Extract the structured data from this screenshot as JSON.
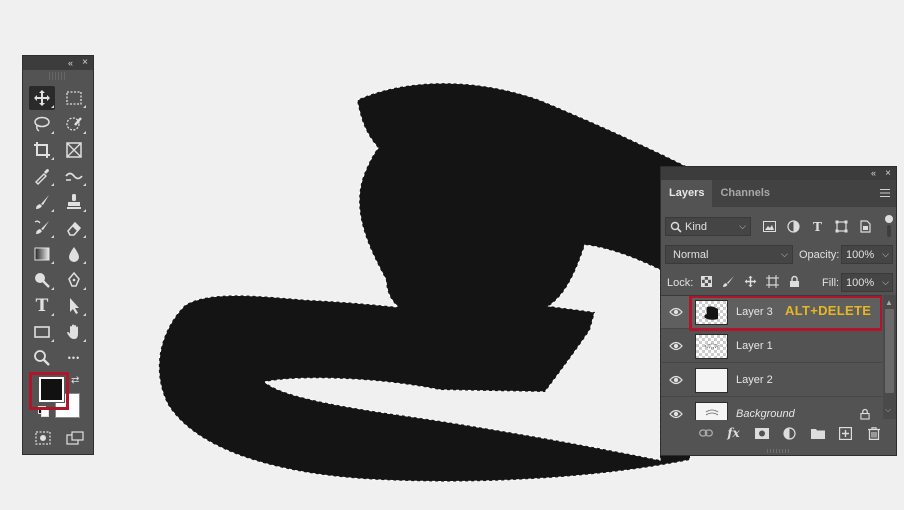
{
  "tools_panel": {
    "collapse_glyph": "«",
    "close_glyph": "×",
    "tools": [
      {
        "name": "move-tool",
        "icon": "move-icon",
        "active": true
      },
      {
        "name": "marquee-tool",
        "icon": "rect-marquee-icon"
      },
      {
        "name": "lasso-tool",
        "icon": "lasso-icon"
      },
      {
        "name": "quick-select-tool",
        "icon": "quick-select-icon"
      },
      {
        "name": "crop-tool",
        "icon": "crop-icon"
      },
      {
        "name": "frame-tool",
        "icon": "frame-icon"
      },
      {
        "name": "eyedropper-tool",
        "icon": "eyedropper-icon"
      },
      {
        "name": "healing-tool",
        "icon": "healing-icon"
      },
      {
        "name": "brush-tool",
        "icon": "brush-icon"
      },
      {
        "name": "stamp-tool",
        "icon": "stamp-icon"
      },
      {
        "name": "history-brush-tool",
        "icon": "history-brush-icon"
      },
      {
        "name": "eraser-tool",
        "icon": "eraser-icon"
      },
      {
        "name": "gradient-tool",
        "icon": "gradient-icon"
      },
      {
        "name": "blur-tool",
        "icon": "drop-icon"
      },
      {
        "name": "dodge-tool",
        "icon": "dodge-icon"
      },
      {
        "name": "pen-tool",
        "icon": "pen-icon"
      },
      {
        "name": "type-tool",
        "icon": "type-icon",
        "text": "T"
      },
      {
        "name": "path-select-tool",
        "icon": "arrow-icon"
      },
      {
        "name": "shape-tool",
        "icon": "rectangle-icon"
      },
      {
        "name": "hand-tool",
        "icon": "hand-icon"
      },
      {
        "name": "zoom-tool",
        "icon": "zoom-icon"
      },
      {
        "name": "more-tools",
        "icon": "ellipsis-icon",
        "text": "•••"
      }
    ],
    "foreground_color": "#111111",
    "background_color": "#ffffff",
    "highlight_color": "#b0162b"
  },
  "layers_panel": {
    "collapse_glyph": "«",
    "close_glyph": "×",
    "tabs": [
      {
        "label": "Layers",
        "active": true
      },
      {
        "label": "Channels",
        "active": false
      }
    ],
    "filter": {
      "label": "Kind",
      "icons": [
        "image-filter-icon",
        "adjustment-filter-icon",
        "type-filter-icon",
        "shape-filter-icon",
        "smart-object-filter-icon"
      ],
      "type_glyph": "T"
    },
    "blend_mode": "Normal",
    "opacity_label": "Opacity:",
    "opacity_value": "100%",
    "lock_label": "Lock:",
    "fill_label": "Fill:",
    "fill_value": "100%",
    "layers": [
      {
        "name": "Layer 3",
        "selected": true,
        "annotation": "ALT+DELETE"
      },
      {
        "name": "Layer 1",
        "selected": false
      },
      {
        "name": "Layer 2",
        "selected": false
      },
      {
        "name": "Background",
        "selected": false,
        "locked": true
      }
    ],
    "footer_icons": [
      "link-icon",
      "fx-icon",
      "mask-icon",
      "adjustment-icon",
      "folder-icon",
      "new-layer-icon",
      "trash-icon"
    ],
    "fx_text": "fx",
    "annotation_color": "#e6b623"
  },
  "canvas": {
    "shape_color": "#141414",
    "background": "#f0f0f0"
  }
}
